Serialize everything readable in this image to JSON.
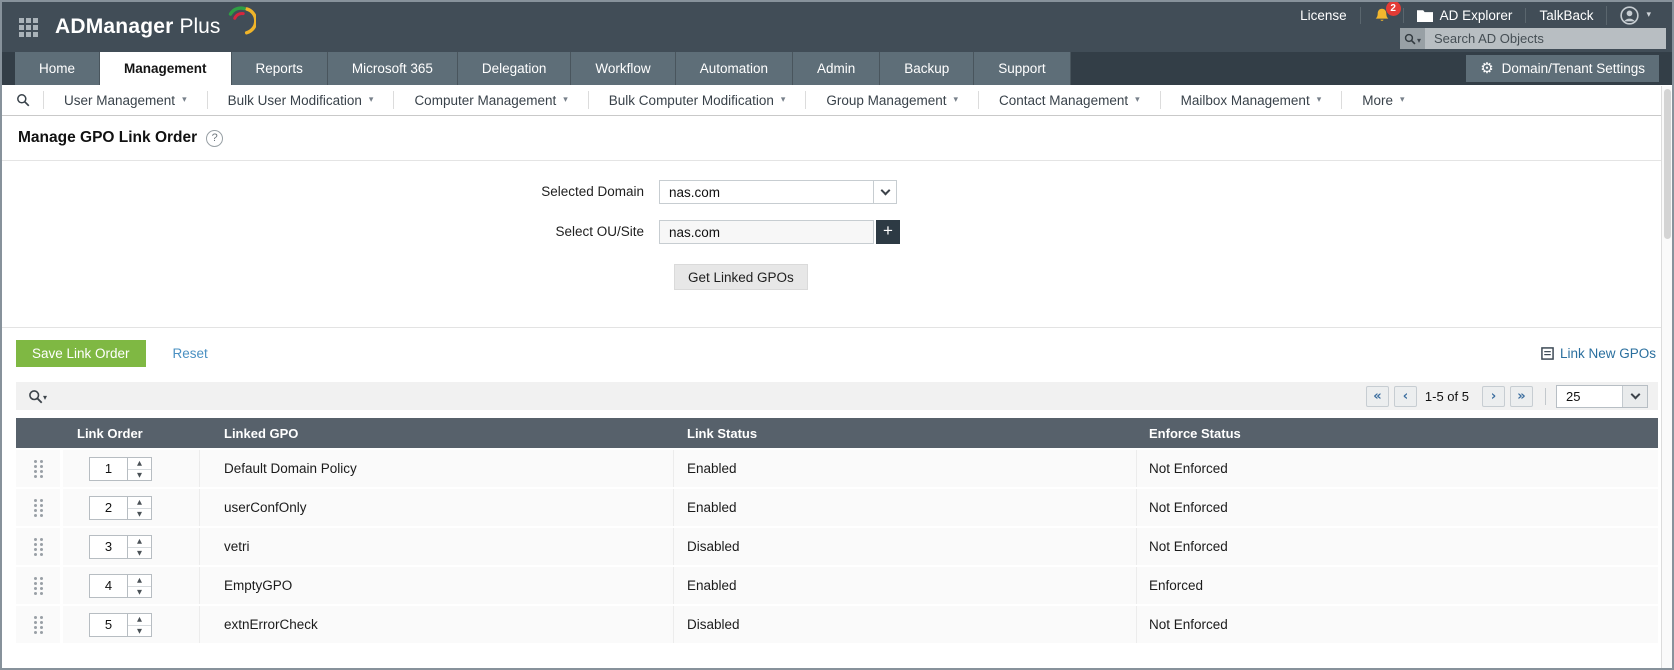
{
  "colors": {
    "topbar_gray": "#414d57",
    "tab_gray": "#5e6e78",
    "accent_green": "#7fb843",
    "link_blue": "#2a6f9e",
    "reset_blue": "#4a90c2",
    "table_header_gray": "#57616b",
    "bell_yellow": "#f3b72e",
    "badge_red": "#e33b35"
  },
  "icons": {
    "caret": "▾",
    "gear": "⚙",
    "plus": "+",
    "help": "?",
    "first": "«",
    "prev": "‹",
    "next": "›",
    "last": "»",
    "spin_up": "▲",
    "spin_down": "▼"
  },
  "topbar": {
    "brand_primary": "ADManager",
    "brand_secondary": "Plus",
    "license": "License",
    "badge_count": "2",
    "ad_explorer": "AD Explorer",
    "talkback": "TalkBack",
    "search_placeholder": "Search AD Objects"
  },
  "nav": {
    "tabs": [
      {
        "label": "Home"
      },
      {
        "label": "Management",
        "active": true
      },
      {
        "label": "Reports"
      },
      {
        "label": "Microsoft 365"
      },
      {
        "label": "Delegation"
      },
      {
        "label": "Workflow"
      },
      {
        "label": "Automation"
      },
      {
        "label": "Admin"
      },
      {
        "label": "Backup"
      },
      {
        "label": "Support"
      }
    ],
    "settings_button": "Domain/Tenant Settings"
  },
  "subnav": {
    "items": [
      {
        "label": "User Management"
      },
      {
        "label": "Bulk User Modification"
      },
      {
        "label": "Computer Management"
      },
      {
        "label": "Bulk Computer Modification"
      },
      {
        "label": "Group Management"
      },
      {
        "label": "Contact Management"
      },
      {
        "label": "Mailbox Management"
      },
      {
        "label": "More"
      }
    ]
  },
  "page": {
    "title": "Manage GPO Link Order"
  },
  "form": {
    "domain_label": "Selected Domain",
    "domain_value": "nas.com",
    "ou_label": "Select OU/Site",
    "ou_value": "nas.com",
    "get_linked_button": "Get Linked GPOs"
  },
  "actions": {
    "save_button": "Save Link Order",
    "reset_link": "Reset",
    "link_new_gpos": "Link New GPOs"
  },
  "toolbar": {
    "range_text": "1-5 of 5",
    "page_size": "25"
  },
  "table": {
    "columns": [
      "Link Order",
      "Linked GPO",
      "Link Status",
      "Enforce Status"
    ],
    "rows": [
      {
        "order": "1",
        "gpo": "Default Domain Policy",
        "link_status": "Enabled",
        "enforce_status": "Not Enforced"
      },
      {
        "order": "2",
        "gpo": "userConfOnly",
        "link_status": "Enabled",
        "enforce_status": "Not Enforced"
      },
      {
        "order": "3",
        "gpo": "vetri",
        "link_status": "Disabled",
        "enforce_status": "Not Enforced"
      },
      {
        "order": "4",
        "gpo": "EmptyGPO",
        "link_status": "Enabled",
        "enforce_status": "Enforced"
      },
      {
        "order": "5",
        "gpo": "extnErrorCheck",
        "link_status": "Disabled",
        "enforce_status": "Not Enforced"
      }
    ]
  }
}
